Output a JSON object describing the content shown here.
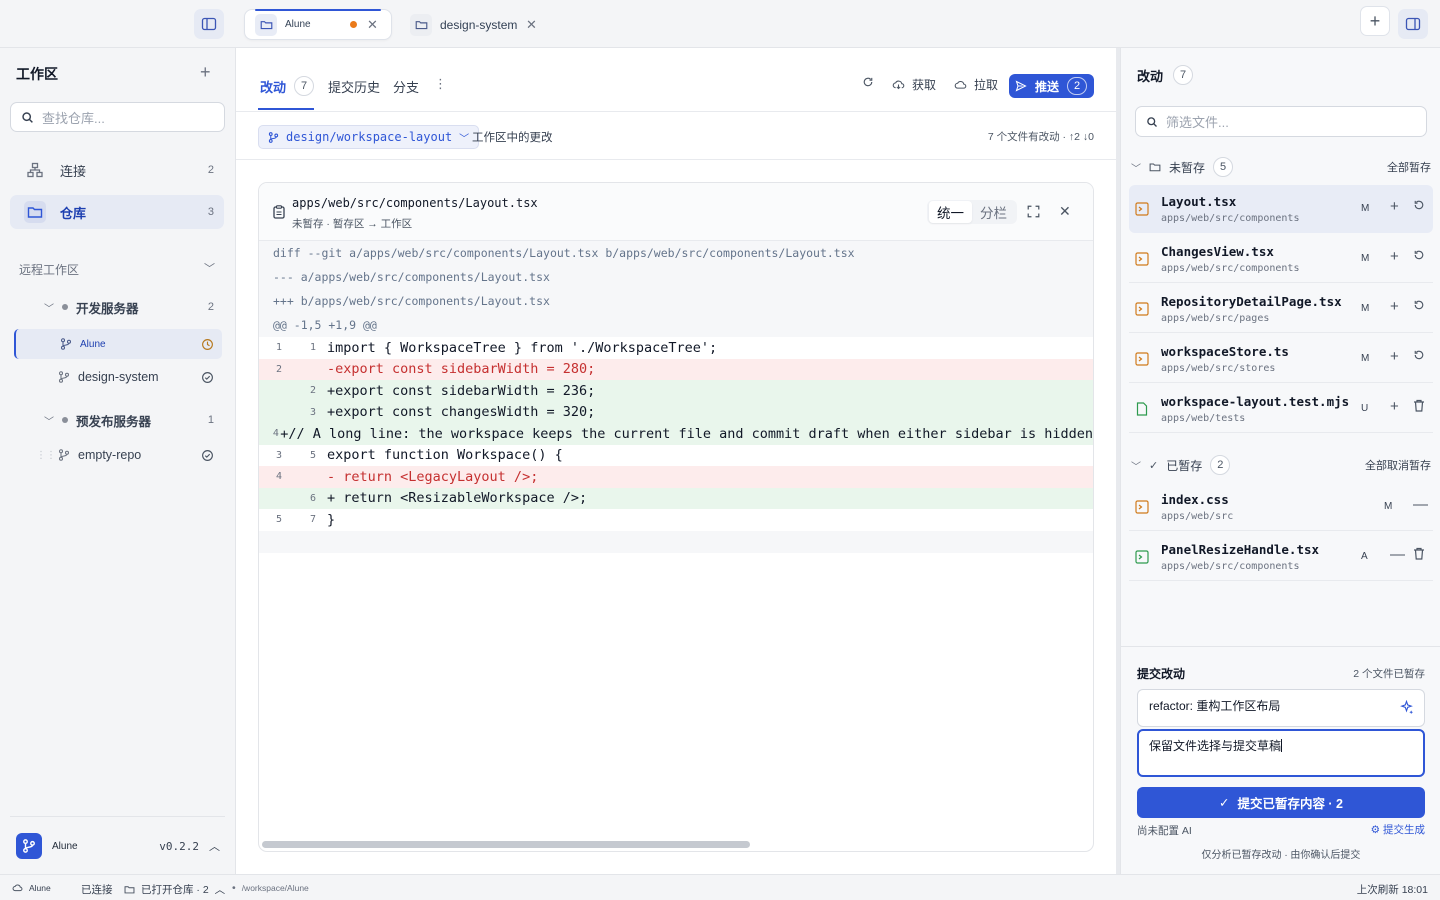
{
  "titlebar": {
    "tabs": [
      {
        "label": "Alune",
        "modified": true
      },
      {
        "label": "design-system",
        "modified": false
      }
    ]
  },
  "sidebar": {
    "title": "工作区",
    "search_placeholder": "查找仓库...",
    "nav": [
      {
        "label": "连接",
        "count": "2"
      },
      {
        "label": "仓库",
        "count": "3"
      }
    ],
    "remote_label": "远程工作区",
    "servers": [
      {
        "name": "开发服务器",
        "count": "2",
        "repos": [
          "Alune",
          "design-system"
        ]
      },
      {
        "name": "预发布服务器",
        "count": "1",
        "repos": [
          "empty-repo"
        ]
      }
    ],
    "app_name": "Alune",
    "version": "v0.2.2"
  },
  "main": {
    "tabs": [
      {
        "label": "改动",
        "count": "7"
      },
      {
        "label": "提交历史"
      },
      {
        "label": "分支"
      }
    ],
    "actions": {
      "fetch": "获取",
      "pull": "拉取",
      "push": "推送",
      "push_count": "2"
    },
    "branch": "design/workspace-layout",
    "changes_label": "工作区中的更改",
    "summary": "7 个文件有改动 · ↑2 ↓0",
    "diff": {
      "file_path": "apps/web/src/components/Layout.tsx",
      "file_sub": "未暂存 · 暂存区 → 工作区",
      "mode_unified": "统一",
      "mode_split": "分栏",
      "meta": [
        "diff --git a/apps/web/src/components/Layout.tsx b/apps/web/src/components/Layout.tsx",
        "--- a/apps/web/src/components/Layout.tsx",
        "+++ b/apps/web/src/components/Layout.tsx",
        "@@ -1,5 +1,9 @@"
      ],
      "lines": [
        {
          "old": "1",
          "new": "1",
          "type": "ctx",
          "text": " import { WorkspaceTree } from './WorkspaceTree';"
        },
        {
          "old": "2",
          "new": "",
          "type": "del",
          "text": "-export const sidebarWidth = 280;"
        },
        {
          "old": "",
          "new": "2",
          "type": "add",
          "text": "+export const sidebarWidth = 236;"
        },
        {
          "old": "",
          "new": "3",
          "type": "add",
          "text": "+export const changesWidth = 320;"
        },
        {
          "old": "",
          "new": "4",
          "type": "add",
          "text": "+// A long line: the workspace keeps the current file and commit draft when either sidebar is hidden"
        },
        {
          "old": "3",
          "new": "5",
          "type": "ctx",
          "text": " export function Workspace() {"
        },
        {
          "old": "4",
          "new": "",
          "type": "del",
          "text": "-  return <LegacyLayout />;"
        },
        {
          "old": "",
          "new": "6",
          "type": "add",
          "text": "+  return <ResizableWorkspace />;"
        },
        {
          "old": "5",
          "new": "7",
          "type": "ctx",
          "text": " }"
        }
      ]
    }
  },
  "changes": {
    "title": "改动",
    "count": "7",
    "filter_placeholder": "筛选文件...",
    "unstaged": {
      "label": "未暂存",
      "count": "5",
      "action": "全部暂存",
      "files": [
        {
          "name": "Layout.tsx",
          "path": "apps/web/src/components",
          "status": "M"
        },
        {
          "name": "ChangesView.tsx",
          "path": "apps/web/src/components",
          "status": "M"
        },
        {
          "name": "RepositoryDetailPage.tsx",
          "path": "apps/web/src/pages",
          "status": "M"
        },
        {
          "name": "workspaceStore.ts",
          "path": "apps/web/src/stores",
          "status": "M"
        },
        {
          "name": "workspace-layout.test.mjs",
          "path": "apps/web/tests",
          "status": "U"
        }
      ]
    },
    "staged": {
      "label": "已暂存",
      "count": "2",
      "action": "全部取消暂存",
      "files": [
        {
          "name": "index.css",
          "path": "apps/web/src",
          "status": "M"
        },
        {
          "name": "PanelResizeHandle.tsx",
          "path": "apps/web/src/components",
          "status": "A"
        }
      ]
    },
    "commit": {
      "title": "提交改动",
      "staged_info": "2 个文件已暂存",
      "summary_value": "refactor: 重构工作区布局",
      "body_value": "保留文件选择与提交草稿",
      "button": "提交已暂存内容 · 2",
      "ai_note": "尚未配置 AI",
      "ai_link": "提交生成",
      "footer": "仅分析已暂存改动 · 由你确认后提交"
    }
  },
  "statusbar": {
    "repo": "Alune",
    "connection": "已连接",
    "opened": "已打开仓库 · 2",
    "path": "/workspace/Alune",
    "refreshed": "上次刷新 18:01"
  },
  "colors": {
    "accent": "#2f56d6",
    "modified_dot": "#ea7a1a",
    "deleted_bg": "#fdecec",
    "added_bg": "#e9f6ec"
  }
}
